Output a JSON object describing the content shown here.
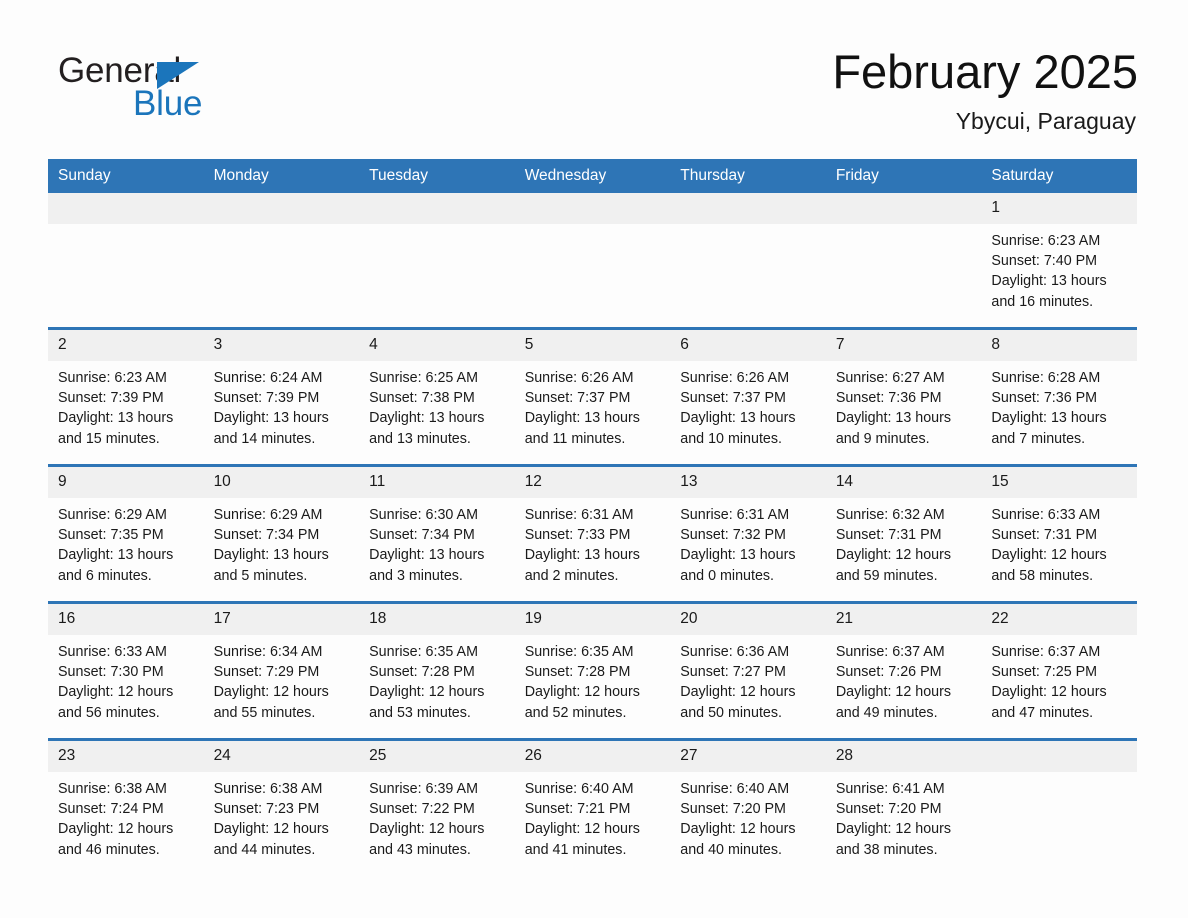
{
  "brand": {
    "name_part1": "General",
    "name_part2": "Blue",
    "accent_color": "#1b75bb"
  },
  "header": {
    "title": "February 2025",
    "location": "Ybycui, Paraguay"
  },
  "theme": {
    "header_blue": "#2e75b6",
    "day_band_gray": "#f0f0f0",
    "page_background": "#fdfdfd"
  },
  "calendar": {
    "weekday_headers": [
      "Sunday",
      "Monday",
      "Tuesday",
      "Wednesday",
      "Thursday",
      "Friday",
      "Saturday"
    ],
    "weeks": [
      [
        {
          "day": "",
          "blank": true,
          "sunrise": "",
          "sunset": "",
          "daylight_line1": "",
          "daylight_line2": ""
        },
        {
          "day": "",
          "blank": true,
          "sunrise": "",
          "sunset": "",
          "daylight_line1": "",
          "daylight_line2": ""
        },
        {
          "day": "",
          "blank": true,
          "sunrise": "",
          "sunset": "",
          "daylight_line1": "",
          "daylight_line2": ""
        },
        {
          "day": "",
          "blank": true,
          "sunrise": "",
          "sunset": "",
          "daylight_line1": "",
          "daylight_line2": ""
        },
        {
          "day": "",
          "blank": true,
          "sunrise": "",
          "sunset": "",
          "daylight_line1": "",
          "daylight_line2": ""
        },
        {
          "day": "",
          "blank": true,
          "sunrise": "",
          "sunset": "",
          "daylight_line1": "",
          "daylight_line2": ""
        },
        {
          "day": "1",
          "blank": false,
          "sunrise": "Sunrise: 6:23 AM",
          "sunset": "Sunset: 7:40 PM",
          "daylight_line1": "Daylight: 13 hours",
          "daylight_line2": "and 16 minutes."
        }
      ],
      [
        {
          "day": "2",
          "blank": false,
          "sunrise": "Sunrise: 6:23 AM",
          "sunset": "Sunset: 7:39 PM",
          "daylight_line1": "Daylight: 13 hours",
          "daylight_line2": "and 15 minutes."
        },
        {
          "day": "3",
          "blank": false,
          "sunrise": "Sunrise: 6:24 AM",
          "sunset": "Sunset: 7:39 PM",
          "daylight_line1": "Daylight: 13 hours",
          "daylight_line2": "and 14 minutes."
        },
        {
          "day": "4",
          "blank": false,
          "sunrise": "Sunrise: 6:25 AM",
          "sunset": "Sunset: 7:38 PM",
          "daylight_line1": "Daylight: 13 hours",
          "daylight_line2": "and 13 minutes."
        },
        {
          "day": "5",
          "blank": false,
          "sunrise": "Sunrise: 6:26 AM",
          "sunset": "Sunset: 7:37 PM",
          "daylight_line1": "Daylight: 13 hours",
          "daylight_line2": "and 11 minutes."
        },
        {
          "day": "6",
          "blank": false,
          "sunrise": "Sunrise: 6:26 AM",
          "sunset": "Sunset: 7:37 PM",
          "daylight_line1": "Daylight: 13 hours",
          "daylight_line2": "and 10 minutes."
        },
        {
          "day": "7",
          "blank": false,
          "sunrise": "Sunrise: 6:27 AM",
          "sunset": "Sunset: 7:36 PM",
          "daylight_line1": "Daylight: 13 hours",
          "daylight_line2": "and 9 minutes."
        },
        {
          "day": "8",
          "blank": false,
          "sunrise": "Sunrise: 6:28 AM",
          "sunset": "Sunset: 7:36 PM",
          "daylight_line1": "Daylight: 13 hours",
          "daylight_line2": "and 7 minutes."
        }
      ],
      [
        {
          "day": "9",
          "blank": false,
          "sunrise": "Sunrise: 6:29 AM",
          "sunset": "Sunset: 7:35 PM",
          "daylight_line1": "Daylight: 13 hours",
          "daylight_line2": "and 6 minutes."
        },
        {
          "day": "10",
          "blank": false,
          "sunrise": "Sunrise: 6:29 AM",
          "sunset": "Sunset: 7:34 PM",
          "daylight_line1": "Daylight: 13 hours",
          "daylight_line2": "and 5 minutes."
        },
        {
          "day": "11",
          "blank": false,
          "sunrise": "Sunrise: 6:30 AM",
          "sunset": "Sunset: 7:34 PM",
          "daylight_line1": "Daylight: 13 hours",
          "daylight_line2": "and 3 minutes."
        },
        {
          "day": "12",
          "blank": false,
          "sunrise": "Sunrise: 6:31 AM",
          "sunset": "Sunset: 7:33 PM",
          "daylight_line1": "Daylight: 13 hours",
          "daylight_line2": "and 2 minutes."
        },
        {
          "day": "13",
          "blank": false,
          "sunrise": "Sunrise: 6:31 AM",
          "sunset": "Sunset: 7:32 PM",
          "daylight_line1": "Daylight: 13 hours",
          "daylight_line2": "and 0 minutes."
        },
        {
          "day": "14",
          "blank": false,
          "sunrise": "Sunrise: 6:32 AM",
          "sunset": "Sunset: 7:31 PM",
          "daylight_line1": "Daylight: 12 hours",
          "daylight_line2": "and 59 minutes."
        },
        {
          "day": "15",
          "blank": false,
          "sunrise": "Sunrise: 6:33 AM",
          "sunset": "Sunset: 7:31 PM",
          "daylight_line1": "Daylight: 12 hours",
          "daylight_line2": "and 58 minutes."
        }
      ],
      [
        {
          "day": "16",
          "blank": false,
          "sunrise": "Sunrise: 6:33 AM",
          "sunset": "Sunset: 7:30 PM",
          "daylight_line1": "Daylight: 12 hours",
          "daylight_line2": "and 56 minutes."
        },
        {
          "day": "17",
          "blank": false,
          "sunrise": "Sunrise: 6:34 AM",
          "sunset": "Sunset: 7:29 PM",
          "daylight_line1": "Daylight: 12 hours",
          "daylight_line2": "and 55 minutes."
        },
        {
          "day": "18",
          "blank": false,
          "sunrise": "Sunrise: 6:35 AM",
          "sunset": "Sunset: 7:28 PM",
          "daylight_line1": "Daylight: 12 hours",
          "daylight_line2": "and 53 minutes."
        },
        {
          "day": "19",
          "blank": false,
          "sunrise": "Sunrise: 6:35 AM",
          "sunset": "Sunset: 7:28 PM",
          "daylight_line1": "Daylight: 12 hours",
          "daylight_line2": "and 52 minutes."
        },
        {
          "day": "20",
          "blank": false,
          "sunrise": "Sunrise: 6:36 AM",
          "sunset": "Sunset: 7:27 PM",
          "daylight_line1": "Daylight: 12 hours",
          "daylight_line2": "and 50 minutes."
        },
        {
          "day": "21",
          "blank": false,
          "sunrise": "Sunrise: 6:37 AM",
          "sunset": "Sunset: 7:26 PM",
          "daylight_line1": "Daylight: 12 hours",
          "daylight_line2": "and 49 minutes."
        },
        {
          "day": "22",
          "blank": false,
          "sunrise": "Sunrise: 6:37 AM",
          "sunset": "Sunset: 7:25 PM",
          "daylight_line1": "Daylight: 12 hours",
          "daylight_line2": "and 47 minutes."
        }
      ],
      [
        {
          "day": "23",
          "blank": false,
          "sunrise": "Sunrise: 6:38 AM",
          "sunset": "Sunset: 7:24 PM",
          "daylight_line1": "Daylight: 12 hours",
          "daylight_line2": "and 46 minutes."
        },
        {
          "day": "24",
          "blank": false,
          "sunrise": "Sunrise: 6:38 AM",
          "sunset": "Sunset: 7:23 PM",
          "daylight_line1": "Daylight: 12 hours",
          "daylight_line2": "and 44 minutes."
        },
        {
          "day": "25",
          "blank": false,
          "sunrise": "Sunrise: 6:39 AM",
          "sunset": "Sunset: 7:22 PM",
          "daylight_line1": "Daylight: 12 hours",
          "daylight_line2": "and 43 minutes."
        },
        {
          "day": "26",
          "blank": false,
          "sunrise": "Sunrise: 6:40 AM",
          "sunset": "Sunset: 7:21 PM",
          "daylight_line1": "Daylight: 12 hours",
          "daylight_line2": "and 41 minutes."
        },
        {
          "day": "27",
          "blank": false,
          "sunrise": "Sunrise: 6:40 AM",
          "sunset": "Sunset: 7:20 PM",
          "daylight_line1": "Daylight: 12 hours",
          "daylight_line2": "and 40 minutes."
        },
        {
          "day": "28",
          "blank": false,
          "sunrise": "Sunrise: 6:41 AM",
          "sunset": "Sunset: 7:20 PM",
          "daylight_line1": "Daylight: 12 hours",
          "daylight_line2": "and 38 minutes."
        },
        {
          "day": "",
          "blank": true,
          "sunrise": "",
          "sunset": "",
          "daylight_line1": "",
          "daylight_line2": ""
        }
      ]
    ]
  }
}
